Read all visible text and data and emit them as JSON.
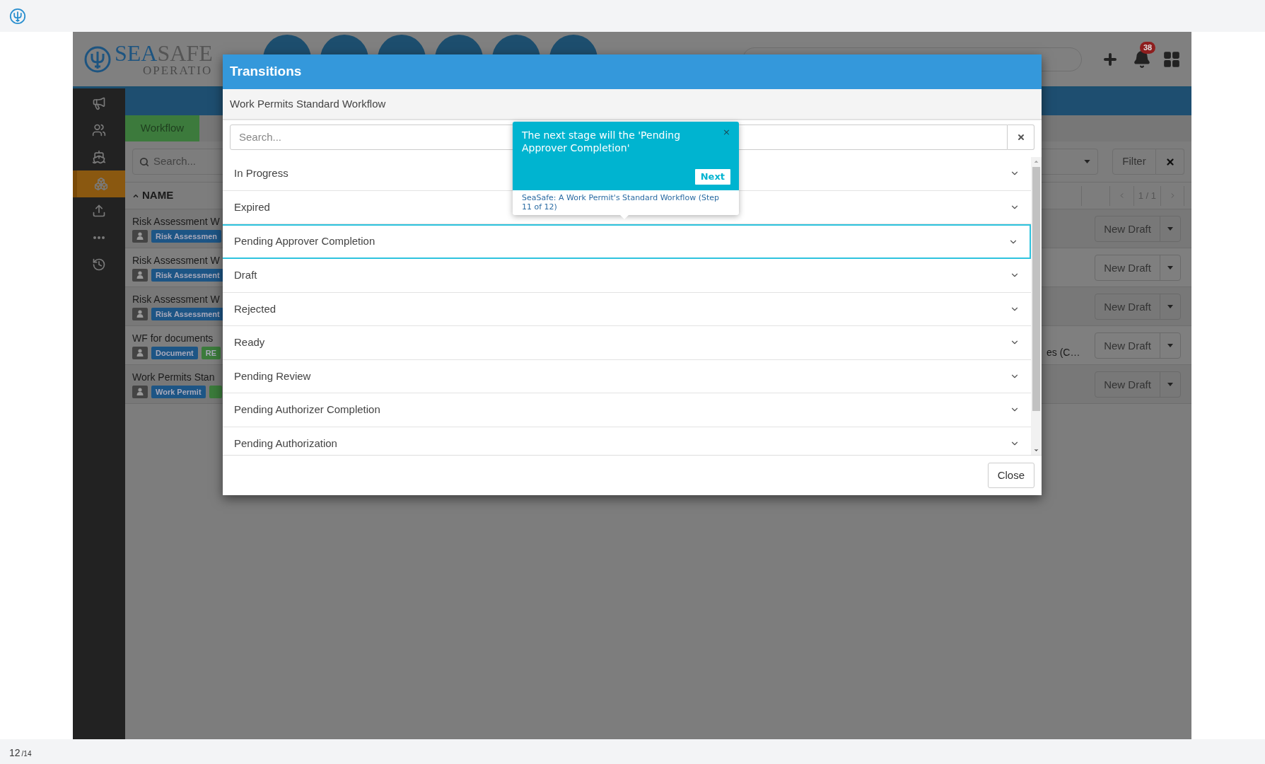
{
  "app": {
    "header": {
      "logo": {
        "brand_first": "SEA",
        "brand_second": "SAFE",
        "subtitle": "OPERATIO"
      },
      "notifications": "38"
    },
    "sidebar": {
      "items": [
        {
          "selected": false
        },
        {
          "selected": false
        },
        {
          "selected": false
        },
        {
          "selected": true
        },
        {
          "selected": false
        },
        {
          "selected": false
        },
        {
          "selected": false
        }
      ]
    },
    "tabs": [
      {
        "label": "Workflow",
        "selected": true
      }
    ],
    "search": {
      "placeholder": "Search..."
    },
    "filter_button": "Filter",
    "table": {
      "columns": [
        "NAME"
      ],
      "pagination": "1 / 1",
      "rows": [
        {
          "name": "Risk Assessment W",
          "tags": [
            {
              "label": "Risk Assessmen",
              "color": "#1d5585"
            }
          ],
          "action": "New Draft"
        },
        {
          "name": "Risk Assessment W",
          "tags": [
            {
              "label": "Risk Assessment",
              "color": "#1d5585"
            }
          ],
          "action": "New Draft"
        },
        {
          "name": "Risk Assessment W",
          "tags": [
            {
              "label": "Risk Assessment",
              "color": "#1d5585"
            }
          ],
          "action": "New Draft"
        },
        {
          "name": "WF for documents",
          "tags": [
            {
              "label": "Document",
              "color": "#1d5585"
            },
            {
              "label": "RE",
              "color": "#3b7b3b"
            }
          ],
          "column_2": "es (C…",
          "action": "New Draft"
        },
        {
          "name": "Work Permits Stan",
          "tags": [
            {
              "label": "Work Permit",
              "color": "#1d5585"
            },
            {
              "color": "#3b7b3b"
            }
          ],
          "action": "New Draft"
        }
      ]
    }
  },
  "modal": {
    "title": "Transitions",
    "subtitle": "Work Permits Standard Workflow",
    "search": {
      "placeholder": "Search..."
    },
    "items": [
      {
        "label": "In Progress",
        "selected": false
      },
      {
        "label": "Expired",
        "selected": false
      },
      {
        "label": "Pending Approver Completion",
        "selected": true
      },
      {
        "label": "Draft",
        "selected": false
      },
      {
        "label": "Rejected",
        "selected": false
      },
      {
        "label": "Ready",
        "selected": false
      },
      {
        "label": "Pending Review",
        "selected": false
      },
      {
        "label": "Pending Authorizer Completion",
        "selected": false
      },
      {
        "label": "Pending Authorization",
        "selected": false
      }
    ],
    "close_button": "Close"
  },
  "tour_popover": {
    "message": "The next stage will the 'Pending Approver Completion'",
    "close": "×",
    "next": "Next",
    "footer": "SeaSafe: A Work Permit's Standard Workflow (Step 11 of 12)"
  },
  "page_counter": {
    "current": "12",
    "total": "/14"
  }
}
